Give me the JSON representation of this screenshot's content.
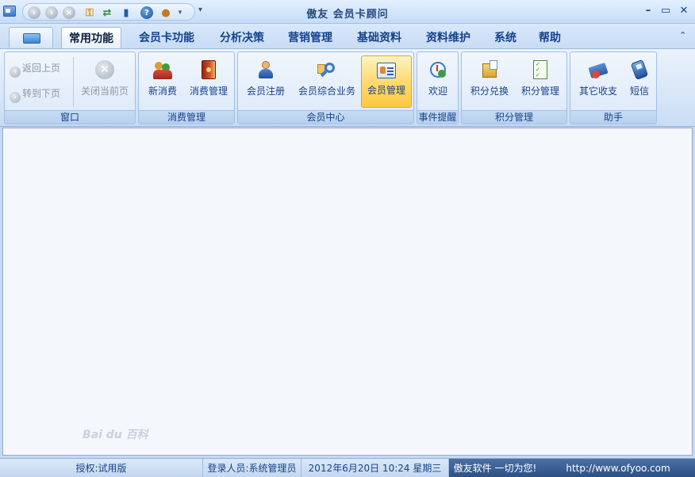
{
  "window": {
    "title": "傲友  会员卡顾问"
  },
  "tabs": [
    {
      "label": "常用功能"
    },
    {
      "label": "会员卡功能"
    },
    {
      "label": "分析决策"
    },
    {
      "label": "营销管理"
    },
    {
      "label": "基础资料"
    },
    {
      "label": "资料维护"
    },
    {
      "label": "系统"
    },
    {
      "label": "帮助"
    }
  ],
  "ribbon": {
    "window_group": {
      "label": "窗口",
      "back": "返回上页",
      "forward": "转到下页",
      "close_page": "关闭当前页"
    },
    "consume_group": {
      "label": "消费管理",
      "new_consume": "新消费",
      "consume_manage": "消费管理"
    },
    "member_group": {
      "label": "会员中心",
      "register": "会员注册",
      "business": "会员综合业务",
      "manage": "会员管理"
    },
    "event_group": {
      "label": "事件提醒",
      "welcome": "欢迎"
    },
    "points_group": {
      "label": "积分管理",
      "exchange": "积分兑换",
      "manage": "积分管理"
    },
    "assistant_group": {
      "label": "助手",
      "other_income": "其它收支",
      "sms": "短信"
    }
  },
  "watermark": "Bai du 百科",
  "statusbar": {
    "license": "授权:试用版",
    "login_user": "登录人员:系统管理员",
    "datetime": "2012年6月20日 10:24 星期三",
    "slogan": "傲友软件 一切为您!",
    "url": "http://www.ofyoo.com"
  }
}
